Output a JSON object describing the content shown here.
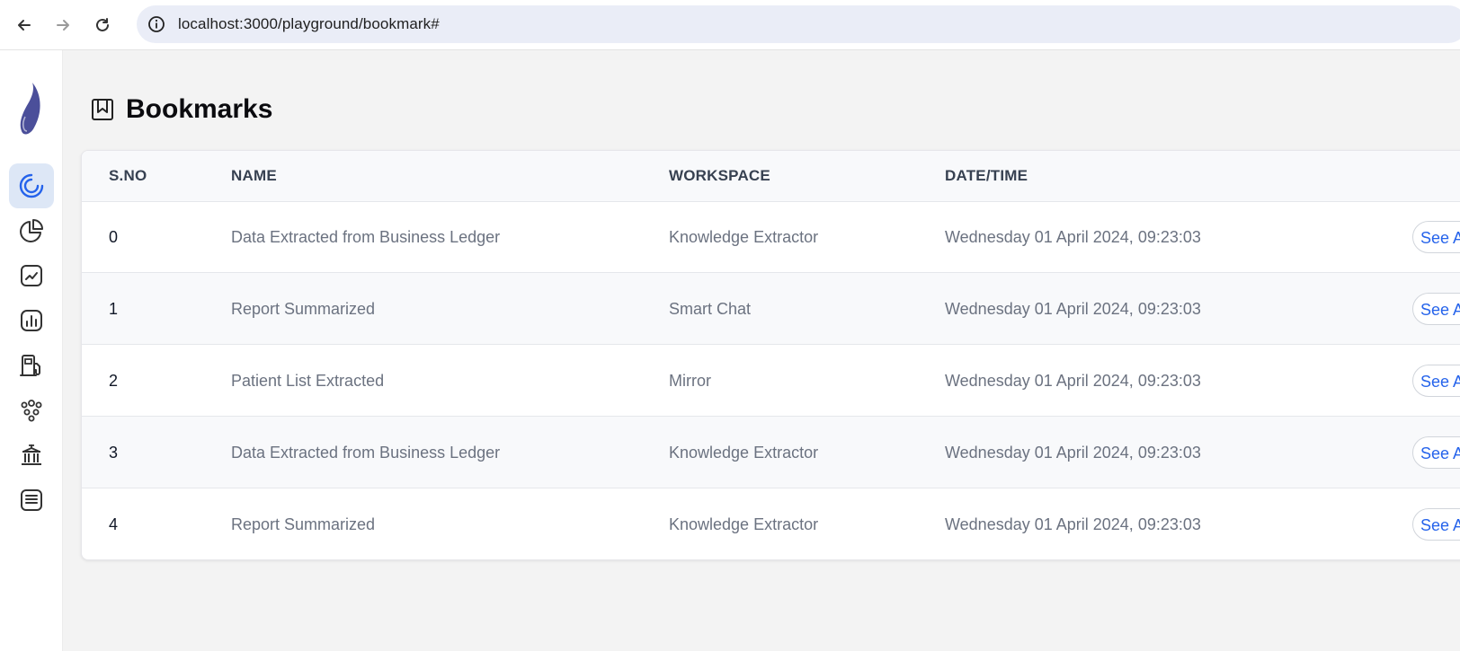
{
  "browser": {
    "url": "localhost:3000/playground/bookmark#",
    "back_icon": "back-arrow-icon",
    "forward_icon": "forward-arrow-icon",
    "reload_icon": "reload-icon",
    "info_icon": "info-icon"
  },
  "sidebar": {
    "logo": "brand-logo",
    "items": [
      {
        "icon": "spinner-icon",
        "active": true
      },
      {
        "icon": "pie-chart-icon",
        "active": false
      },
      {
        "icon": "trend-chart-icon",
        "active": false
      },
      {
        "icon": "bar-chart-icon",
        "active": false
      },
      {
        "icon": "fuel-pump-icon",
        "active": false
      },
      {
        "icon": "people-group-icon",
        "active": false
      },
      {
        "icon": "institution-icon",
        "active": false
      },
      {
        "icon": "receipt-icon",
        "active": false
      }
    ]
  },
  "page": {
    "title": "Bookmarks",
    "title_icon": "bookmark-icon"
  },
  "table": {
    "columns": [
      "S.NO",
      "NAME",
      "WORKSPACE",
      "DATE/TIME"
    ],
    "action_label": "See A",
    "rows": [
      {
        "sno": "0",
        "name": "Data Extracted from Business Ledger",
        "workspace": "Knowledge Extractor",
        "datetime": "Wednesday 01 April 2024, 09:23:03"
      },
      {
        "sno": "1",
        "name": "Report Summarized",
        "workspace": "Smart Chat",
        "datetime": "Wednesday 01 April 2024, 09:23:03"
      },
      {
        "sno": "2",
        "name": "Patient List Extracted",
        "workspace": "Mirror",
        "datetime": "Wednesday 01 April 2024, 09:23:03"
      },
      {
        "sno": "3",
        "name": "Data Extracted from Business Ledger",
        "workspace": "Knowledge Extractor",
        "datetime": "Wednesday 01 April 2024, 09:23:03"
      },
      {
        "sno": "4",
        "name": "Report Summarized",
        "workspace": "Knowledge Extractor",
        "datetime": "Wednesday 01 April 2024, 09:23:03"
      }
    ]
  },
  "colors": {
    "accent": "#2563eb",
    "logo": "#4b4f9a",
    "active_nav_bg": "#dde7f6",
    "page_bg": "#f3f3f3"
  }
}
